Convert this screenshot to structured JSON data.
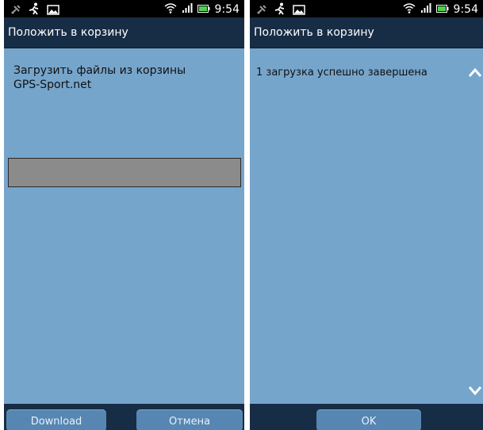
{
  "status_bar": {
    "time": "9:54",
    "left_icons": [
      "satellite-icon",
      "runner-icon",
      "image-icon"
    ],
    "right_icons": [
      "wifi-icon",
      "signal-icon",
      "battery-icon"
    ]
  },
  "dialog_download": {
    "title": "Положить в корзину",
    "message": "Загрузить файлы из корзины\nGPS-Sport.net",
    "progress": 0,
    "buttons": {
      "download": "Download",
      "cancel": "Отмена"
    }
  },
  "dialog_result": {
    "title": "Положить в корзину",
    "message": "1 загрузка успешно завершена",
    "buttons": {
      "ok": "OK"
    },
    "scroll_icons": [
      "chevron-up-icon",
      "chevron-down-icon"
    ]
  },
  "colors": {
    "status_bar": "#000000",
    "title_bar": "#172d45",
    "content_background": "#76a5cc",
    "button": "#5786b2",
    "progress_track": "#8b8b8b",
    "battery": "#4fd14f"
  }
}
